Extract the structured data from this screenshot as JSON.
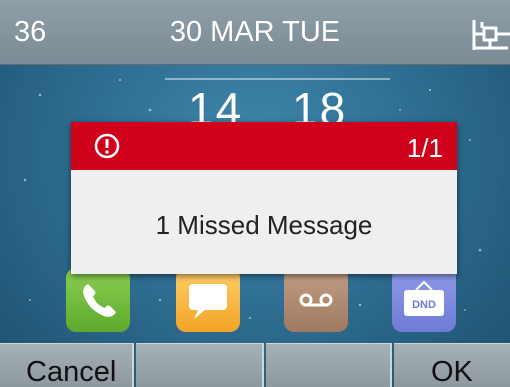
{
  "status_bar": {
    "extension": "36",
    "date": "30 MAR TUE",
    "network_icon": "network-icon"
  },
  "clock": {
    "hours": "14",
    "minutes": "18"
  },
  "popup": {
    "icon": "alert-icon",
    "counter": "1/1",
    "message": "1 Missed Message",
    "header_color": "#d0021b"
  },
  "apps": [
    {
      "name": "phone",
      "icon": "phone-icon"
    },
    {
      "name": "messages",
      "icon": "message-icon"
    },
    {
      "name": "voicemail",
      "icon": "voicemail-icon"
    },
    {
      "name": "dnd",
      "icon": "dnd-icon",
      "label": "DND"
    }
  ],
  "softkeys": {
    "left": "Cancel",
    "right": "OK"
  }
}
